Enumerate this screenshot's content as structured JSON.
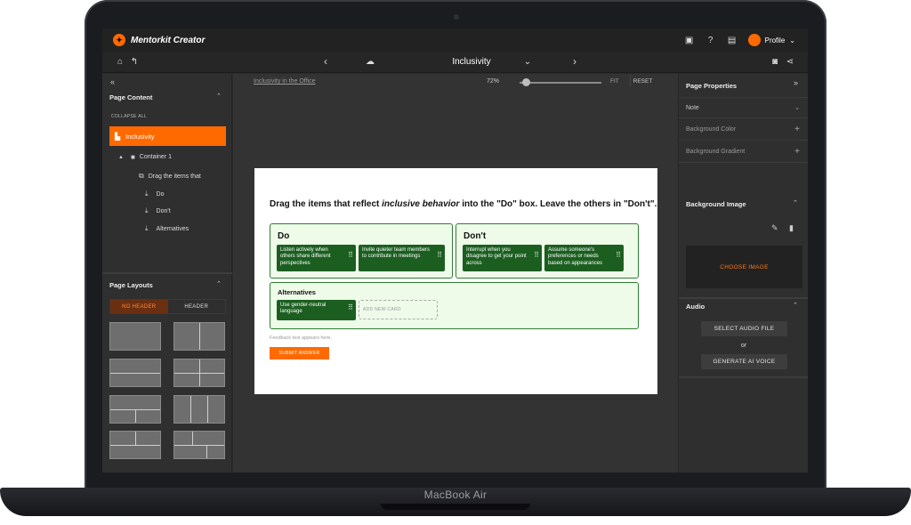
{
  "device": {
    "label": "MacBook Air"
  },
  "app": {
    "title": "Mentorkit Creator",
    "logo_icon": "mentorkit-logo-icon",
    "profile_label": "Profile",
    "accent": "#ff6a00"
  },
  "toolbar": {
    "page_title": "Inclusivity"
  },
  "left_panel": {
    "content_heading": "Page Content",
    "collapse_all": "COLLAPSE ALL",
    "selected_item": "Inclusivity",
    "container": "Container 1",
    "items": [
      "Drag the items that",
      "Do",
      "Don't",
      "Alternatives"
    ],
    "layouts_heading": "Page Layouts",
    "layout_tabs": [
      "NO HEADER",
      "HEADER"
    ]
  },
  "canvas": {
    "breadcrumb": "Inclusivity in the Office",
    "zoom": "72%",
    "fit": "FIT",
    "reset": "RESET"
  },
  "activity": {
    "question_pre": "Drag the items that reflect ",
    "question_em": "inclusive behavior",
    "question_mid": " into the ",
    "question_do": "\"Do\"",
    "question_mid2": " box. Leave the others in ",
    "question_dont": "\"Don't\"",
    "question_end": ".",
    "do_title": "Do",
    "dont_title": "Don't",
    "alt_title": "Alternatives",
    "do_cards": [
      "Listen actively when others share different perspectives",
      "Invite quieter team members to contribute in meetings"
    ],
    "dont_cards": [
      "Interrupt when you disagree to get your point across",
      "Assume someone's preferences or needs based on appearances"
    ],
    "alt_cards": [
      "Use gender-neutral language"
    ],
    "add_card": "ADD NEW CARD",
    "feedback": "Feedback text appears here.",
    "submit": "SUBMIT ANSWER"
  },
  "right_panel": {
    "heading": "Page Properties",
    "note": "Note",
    "bg_color": "Background Color",
    "bg_gradient": "Background Gradient",
    "bg_image": "Background Image",
    "choose_image": "CHOOSE IMAGE",
    "audio": "Audio",
    "select_audio": "SELECT AUDIO FILE",
    "or": "or",
    "generate_voice": "GENERATE AI VOICE"
  }
}
